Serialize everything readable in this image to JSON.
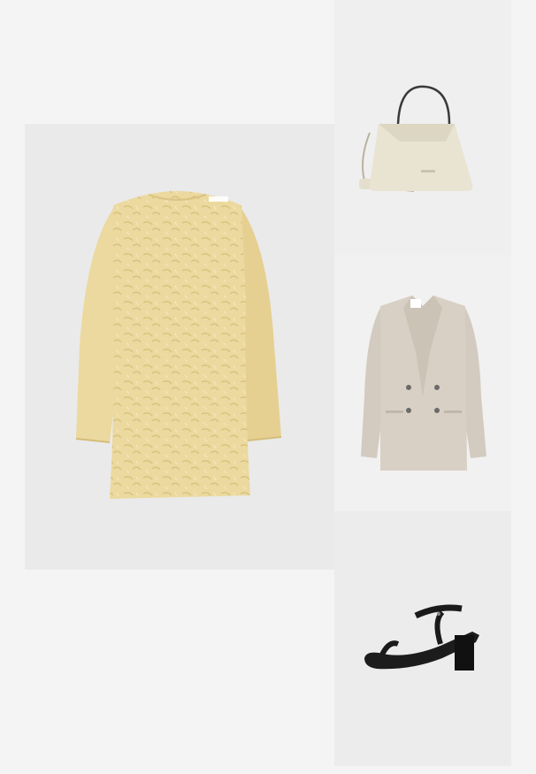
{
  "outfit": {
    "items": [
      {
        "id": "dress",
        "type": "dress",
        "color": "#ecd99f"
      },
      {
        "id": "bag",
        "type": "handbag",
        "color": "#e9e3d2"
      },
      {
        "id": "blazer",
        "type": "blazer",
        "color": "#d8d0c4"
      },
      {
        "id": "shoe",
        "type": "sandal",
        "color": "#1a1a1a"
      }
    ]
  },
  "colors": {
    "page_background": "#f4f4f4",
    "tile_background": "#eaeaea"
  }
}
